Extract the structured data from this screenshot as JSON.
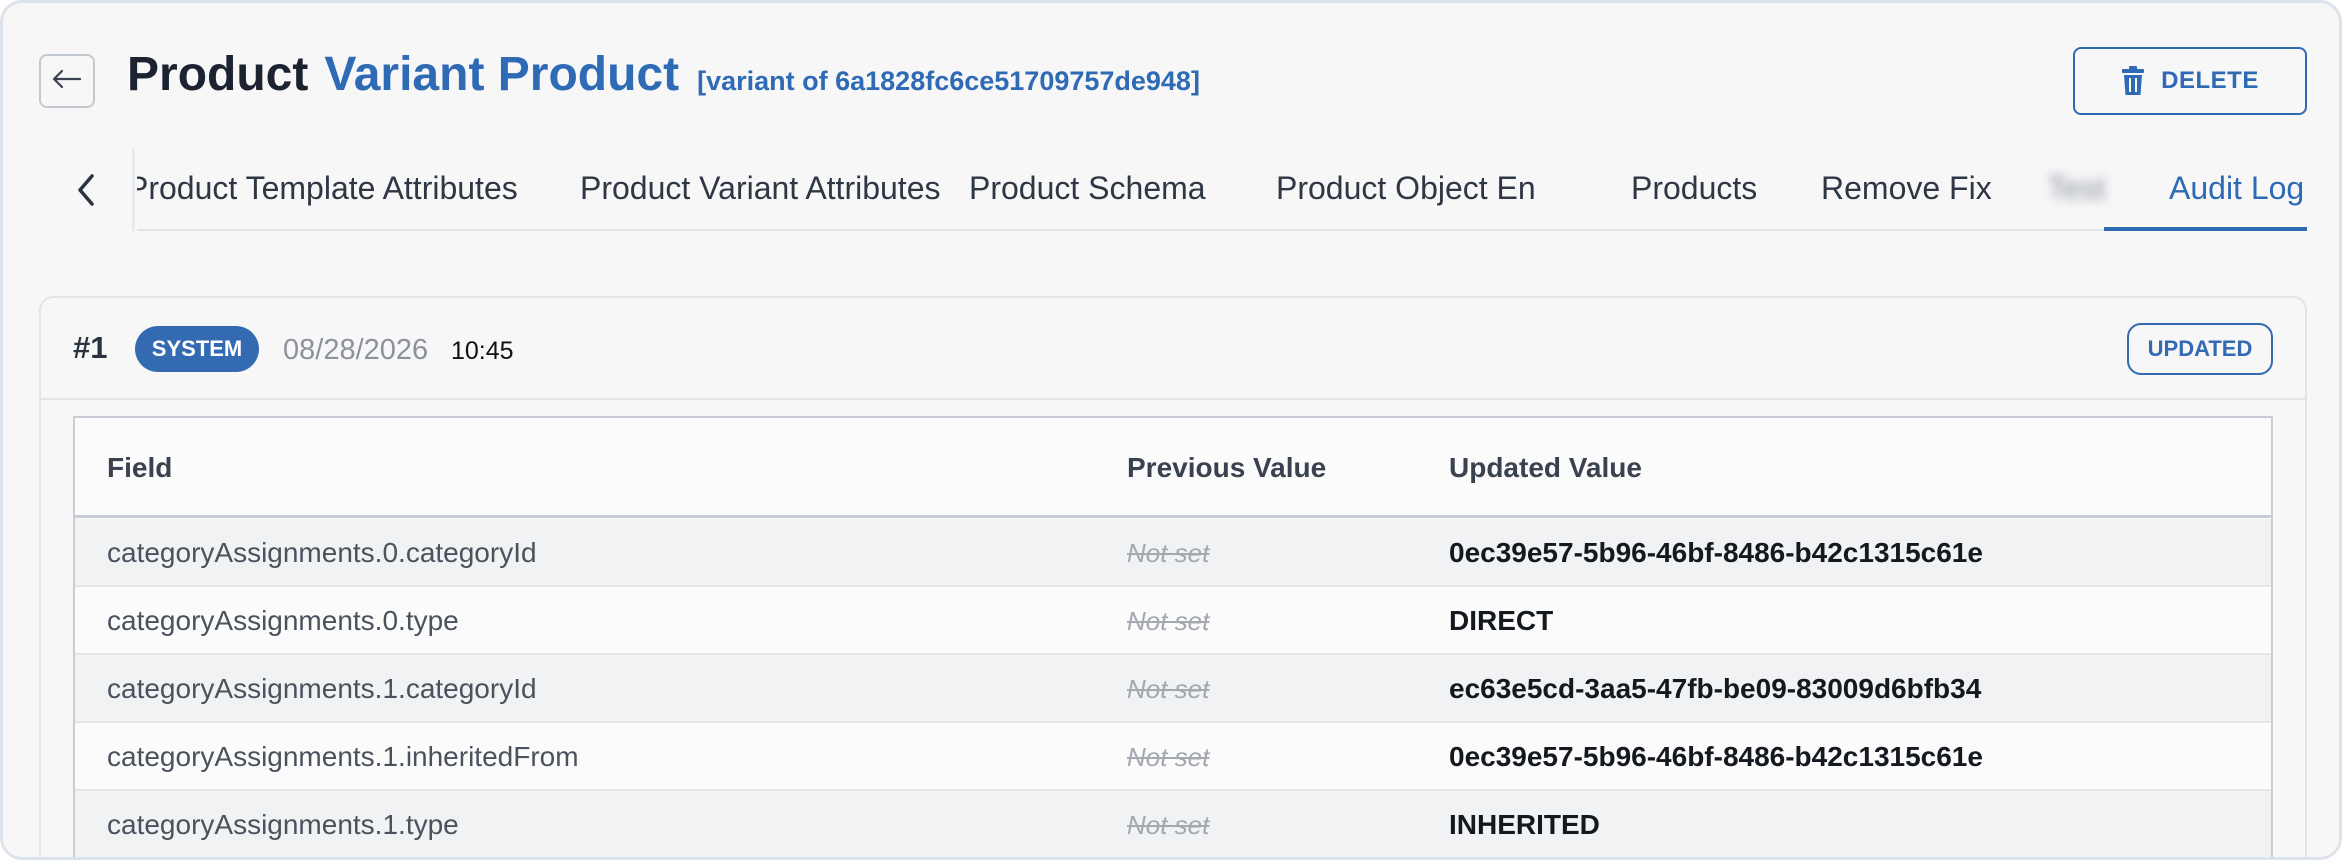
{
  "header": {
    "title": "Product",
    "subtitle": "Variant Product",
    "variant_label": "[variant of 6a1828fc6ce51709757de948]",
    "delete_label": "DELETE",
    "back_icon": "arrow-left-icon",
    "delete_icon": "trash-icon"
  },
  "tabs": {
    "items": [
      {
        "label": "Product Template Attributes"
      },
      {
        "label": "Product Variant Attributes"
      },
      {
        "label": "Product Schema"
      },
      {
        "label": "Product Object En"
      },
      {
        "label": "Products"
      },
      {
        "label": "Remove Fix"
      },
      {
        "label": "Test"
      },
      {
        "label": "Audit Log"
      }
    ],
    "active": "Audit Log",
    "prev_icon": "chevron-left-icon"
  },
  "entry": {
    "number": "#1",
    "actor": "SYSTEM",
    "date": "08/28/2026",
    "time": "10:45",
    "action": "UPDATED"
  },
  "table": {
    "headers": {
      "field": "Field",
      "previous": "Previous Value",
      "updated": "Updated Value"
    },
    "rows": [
      {
        "field": "categoryAssignments.0.categoryId",
        "previous": "Not set",
        "updated": "0ec39e57-5b96-46bf-8486-b42c1315c61e"
      },
      {
        "field": "categoryAssignments.0.type",
        "previous": "Not set",
        "updated": "DIRECT"
      },
      {
        "field": "categoryAssignments.1.categoryId",
        "previous": "Not set",
        "updated": "ec63e5cd-3aa5-47fb-be09-83009d6bfb34"
      },
      {
        "field": "categoryAssignments.1.inheritedFrom",
        "previous": "Not set",
        "updated": "0ec39e57-5b96-46bf-8486-b42c1315c61e"
      },
      {
        "field": "categoryAssignments.1.type",
        "previous": "Not set",
        "updated": "INHERITED"
      }
    ]
  },
  "colors": {
    "accent": "#2f6ab5",
    "badge_bg": "#336ab1",
    "text_dark": "#1b2230",
    "muted": "#8c929b"
  }
}
